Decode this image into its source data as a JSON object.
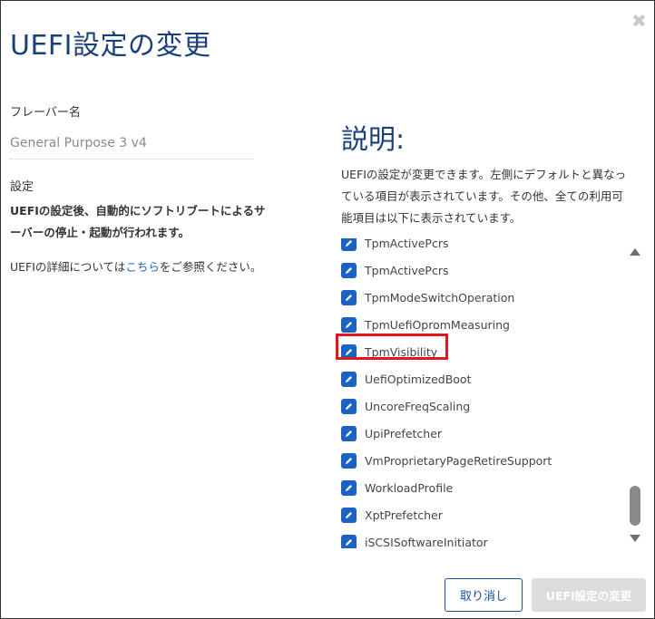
{
  "dialog": {
    "title": "UEFI設定の変更",
    "close_glyph": "✖"
  },
  "left": {
    "flavor_label": "フレーバー名",
    "flavor_value": "General Purpose 3 v4",
    "setting_label": "設定",
    "warning_line1": "UEFIの設定後、自動的にソフトリブートによるサ",
    "warning_line2": "ーバーの停止・起動が行われます。",
    "detail_before": "UEFIの詳細については",
    "detail_link": "こちら",
    "detail_after": "をご参照ください。"
  },
  "right": {
    "desc_title": "説明:",
    "desc_line1": "UEFIの設定が変更できます。左側にデフォルトと異なっ",
    "desc_line2": "ている項目が表示されています。その他、全ての利用可",
    "desc_line3": "能項目は以下に表示されています。",
    "items": [
      "TpmActivePcrs",
      "TpmActivePcrs",
      "TpmModeSwitchOperation",
      "TpmUefiOpromMeasuring",
      "TpmVisibility",
      "UefiOptimizedBoot",
      "UncoreFreqScaling",
      "UpiPrefetcher",
      "VmProprietaryPageRetireSupport",
      "WorkloadProfile",
      "XptPrefetcher",
      "iSCSISoftwareInitiator"
    ]
  },
  "buttons": {
    "cancel": "取り消し",
    "apply": "UEFI設定の変更"
  },
  "colors": {
    "accent": "#1b3f7c",
    "icon": "#1a63c4",
    "highlight": "#e0161c"
  }
}
